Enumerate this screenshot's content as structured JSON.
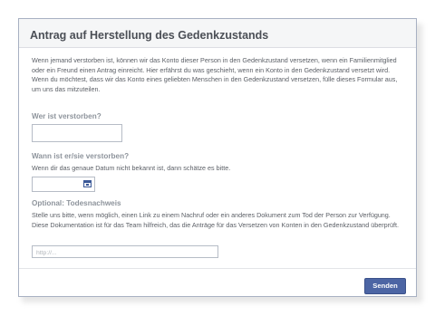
{
  "dialog": {
    "title": "Antrag auf Herstellung des Gedenkzustands",
    "intro": "Wenn jemand verstorben ist, können wir das Konto dieser Person in den Gedenkzustand versetzen, wenn ein Familienmitglied oder ein Freund einen Antrag einreicht. Hier erfährst du was geschieht, wenn ein Konto in den Gedenkzustand versetzt wird. Wenn du möchtest, dass wir das Konto eines geliebten Menschen in den Gedenkzustand versetzen, fülle dieses Formular aus, um uns das mitzuteilen."
  },
  "form": {
    "deceased_label": "Wer ist verstorben?",
    "deceased_value": "",
    "date_label": "Wann ist er/sie verstorben?",
    "date_hint": "Wenn dir das genaue Datum nicht bekannt ist, dann schätze es bitte.",
    "date_value": "",
    "proof_label": "Optional: Todesnachweis",
    "proof_hint": "Stelle uns bitte, wenn möglich, einen Link zu einem Nachruf oder ein anderes Dokument zum Tod der Person zur Verfügung. Diese Dokumentation ist für das Team hilfreich, das die Anträge für das Versetzen von Konten in den Gedenkzustand überprüft.",
    "proof_placeholder": "http://...",
    "proof_value": ""
  },
  "footer": {
    "send_label": "Senden"
  },
  "colors": {
    "button": "#4c65a4",
    "title": "#4b4f56",
    "label": "#8e949c"
  },
  "icons": {
    "date_picker": "calendar-icon"
  }
}
